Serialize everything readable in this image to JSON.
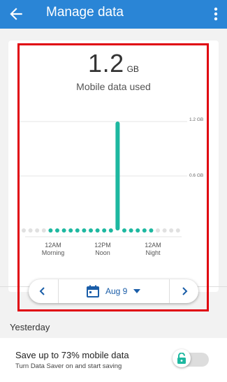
{
  "app_bar": {
    "title": "Manage data",
    "back_icon": "arrow-back-icon",
    "more_icon": "more-vert-icon",
    "color": "#2a85d6"
  },
  "usage": {
    "value": "1.2",
    "unit": "GB",
    "caption": "Mobile data used"
  },
  "chart_data": {
    "type": "bar",
    "y_ticks": [
      "1.2 GB",
      "0.6 GB"
    ],
    "x_labels": [
      {
        "line1": "12AM",
        "line2": "Morning"
      },
      {
        "line1": "12PM",
        "line2": "Noon"
      },
      {
        "line1": "12AM",
        "line2": "Night"
      }
    ],
    "x": [
      0,
      1,
      2,
      3,
      4,
      5,
      6,
      7,
      8,
      9,
      10,
      11,
      12,
      13,
      14,
      15,
      16,
      17,
      18,
      19,
      20,
      21,
      22,
      23
    ],
    "values": [
      0,
      0,
      0,
      0,
      0.01,
      0.01,
      0.01,
      0.01,
      0.01,
      0.01,
      0.01,
      0.01,
      0.01,
      0.01,
      1.2,
      0.01,
      0.01,
      0.01,
      0.01,
      0.01,
      0,
      0,
      0,
      0
    ],
    "ylim": [
      0,
      1.2
    ],
    "colors": {
      "bar": "#1db8a0",
      "empty": "#e0e0e0"
    }
  },
  "date_selector": {
    "date": "Aug 9",
    "prev_icon": "chevron-left-icon",
    "next_icon": "chevron-right-icon",
    "calendar_icon": "calendar-icon",
    "dropdown_icon": "caret-down-icon"
  },
  "section": {
    "label": "Yesterday"
  },
  "data_saver": {
    "title": "Save up to 73% mobile data",
    "subtitle": "Turn Data Saver on and start saving",
    "toggle_icon": "lock-icon",
    "enabled": false
  }
}
